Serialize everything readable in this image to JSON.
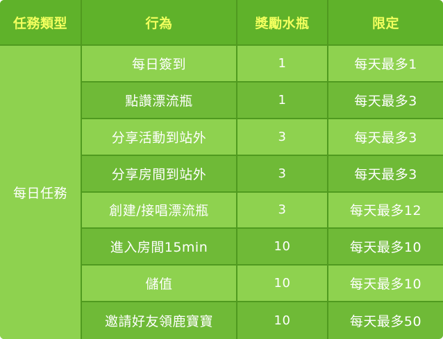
{
  "header": {
    "col_type": "任務類型",
    "col_action": "行為",
    "col_reward": "獎勵水瓶",
    "col_limit": "限定"
  },
  "task_type": "每日任務",
  "rows": [
    {
      "action": "每日簽到",
      "reward": "1",
      "limit": "每天最多1"
    },
    {
      "action": "點讚漂流瓶",
      "reward": "1",
      "limit": "每天最多3"
    },
    {
      "action": "分享活動到站外",
      "reward": "3",
      "limit": "每天最多3"
    },
    {
      "action": "分享房間到站外",
      "reward": "3",
      "limit": "每天最多3"
    },
    {
      "action": "創建/接唱漂流瓶",
      "reward": "3",
      "limit": "每天最多12"
    },
    {
      "action": "進入房間15min",
      "reward": "10",
      "limit": "每天最多10"
    },
    {
      "action": "儲值",
      "reward": "10",
      "limit": "每天最多10"
    },
    {
      "action": "邀請好友領鹿寶寶",
      "reward": "10",
      "limit": "每天最多50"
    }
  ],
  "colors": {
    "header_bg": "#5fb22a",
    "header_text": "#f2ff5e",
    "row_light": "#8ed24f",
    "row_dark": "#6fba37"
  }
}
